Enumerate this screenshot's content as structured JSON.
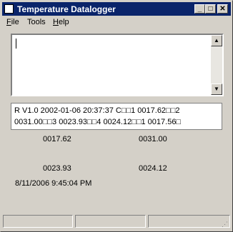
{
  "window": {
    "title": "Temperature Datalogger",
    "controls": {
      "minimize": "_",
      "maximize": "□",
      "close": "✕"
    }
  },
  "menu": {
    "file": {
      "accel": "F",
      "rest": "ile"
    },
    "tools": {
      "label": "Tools"
    },
    "help": {
      "accel": "H",
      "rest": "elp"
    }
  },
  "input_text": "",
  "scroll_arrows": {
    "up": "▲",
    "down": "▼"
  },
  "readout": {
    "line1": "R V1.0 2002-01-06 20:37:37 C□□1 0017.62□□2",
    "line2": "0031.00□□3 0023.93□□4 0024.12□□1 0017.56□"
  },
  "channels": {
    "ch1": "0017.62",
    "ch2": "0031.00",
    "ch3": "0023.93",
    "ch4": "0024.12"
  },
  "timestamp": "8/11/2006 9:45:04 PM",
  "status": {
    "grip": "⋰"
  }
}
